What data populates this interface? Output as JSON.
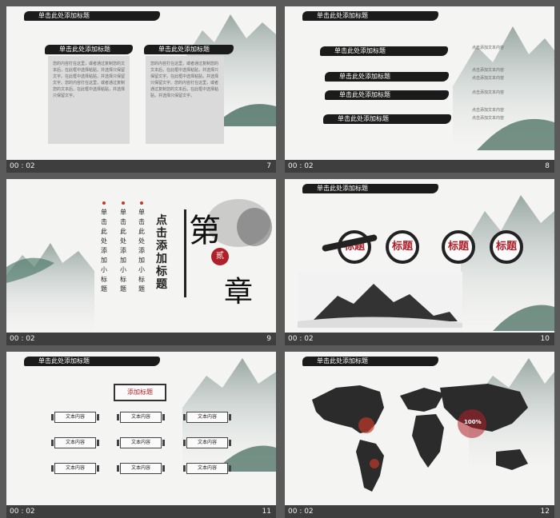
{
  "slides": [
    {
      "number": "7",
      "time": "00 : 02",
      "brand": "单击此处添加标题",
      "left": {
        "title": "单击此处添加标题",
        "text": "您的内容打在这里，或者通过复制您的文本后，在此框中选择粘贴，并选择只保留文字。在此框中选择粘贴，并选择只保留文字。您的内容打在这里，或者通过复制您的文本后，在此框中选择粘贴，并选择只保留文字。"
      },
      "right": {
        "title": "单击此处添加标题",
        "text": "您的内容打在这里，或者通过复制您的文本后，在此框中选择粘贴，并选择只保留文字。在此框中选择粘贴，并选择只保留文字。您的内容打在这里，或者通过复制您的文本后，在此框中选择粘贴，并选择只保留文字。"
      }
    },
    {
      "number": "8",
      "time": "00 : 02",
      "brand": "单击此处添加标题",
      "items": [
        "单击此处添加标题",
        "单击此处添加标题",
        "单击此处添加标题",
        "单击此处添加标题"
      ],
      "notes": [
        "点击添加文本内容",
        "点击添加文本内容",
        "点击添加文本内容",
        "点击添加文本内容",
        "点击添加文本内容",
        "点击添加文本内容"
      ]
    },
    {
      "number": "9",
      "time": "00 : 02",
      "title": "点击添加标题",
      "subcols": [
        "单击此处添加小标题",
        "单击此处添加小标题",
        "单击此处添加小标题"
      ],
      "big1": "第",
      "big2": "章",
      "seal": "贰"
    },
    {
      "number": "10",
      "time": "00 : 02",
      "brand": "单击此处添加标题",
      "circles": [
        "标题",
        "标题",
        "标题",
        "标题"
      ]
    },
    {
      "number": "11",
      "time": "00 : 02",
      "brand": "单击此处添加标题",
      "button": "添加标题",
      "boxes": [
        "文本内容",
        "文本内容",
        "文本内容",
        "文本内容",
        "文本内容",
        "文本内容",
        "文本内容",
        "文本内容",
        "文本内容"
      ]
    },
    {
      "number": "12",
      "time": "00 : 02",
      "brand": "单击此处添加标题",
      "marker": "100%"
    }
  ]
}
